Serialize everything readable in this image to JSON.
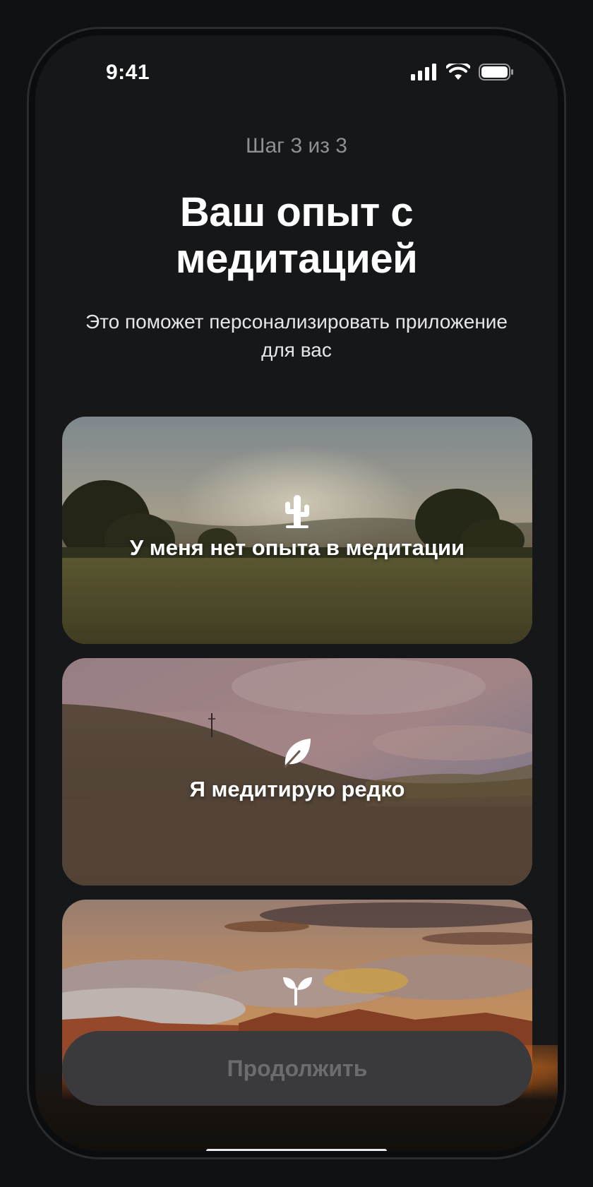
{
  "status_bar": {
    "time": "9:41",
    "icons": [
      "signal-icon",
      "wifi-icon",
      "battery-icon"
    ]
  },
  "onboarding": {
    "step": "Шаг 3 из 3",
    "title_line1": "Ваш опыт с",
    "title_line2": "медитацией",
    "subtitle_line1": "Это поможет персонализировать приложение",
    "subtitle_line2": "для вас"
  },
  "options": [
    {
      "label": "У меня нет опыта в медитации",
      "icon": "cactus-icon"
    },
    {
      "label": "Я медитирую редко",
      "icon": "leaf-icon"
    },
    {
      "label": "",
      "icon": "sprout-icon"
    }
  ],
  "continue_label": "Продолжить"
}
